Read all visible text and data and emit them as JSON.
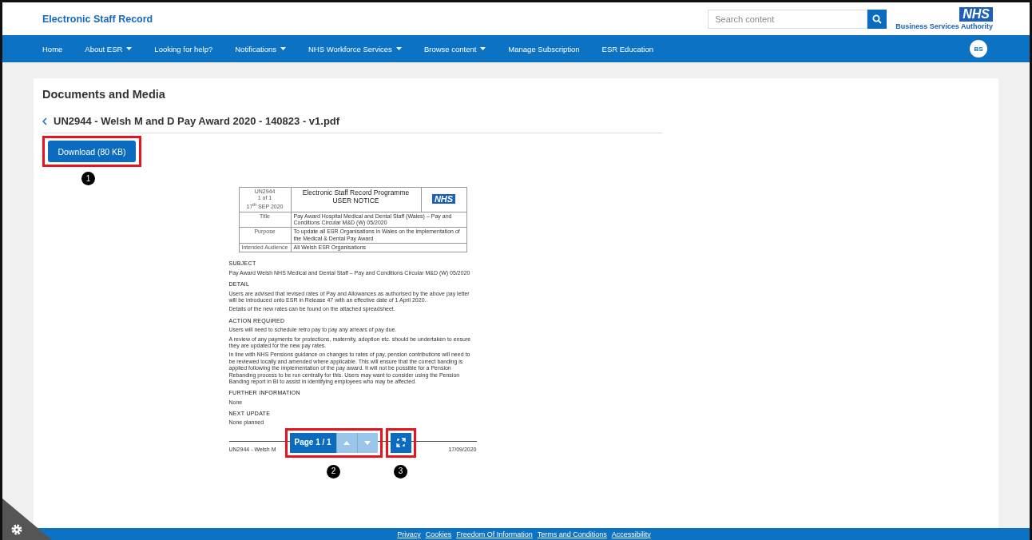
{
  "header": {
    "title": "Electronic Staff Record",
    "search": {
      "placeholder": "Search content"
    },
    "logo": {
      "mark": "NHS",
      "subtitle": "Business Services Authority"
    }
  },
  "nav": {
    "items": [
      {
        "label": "Home",
        "dropdown": false
      },
      {
        "label": "About ESR",
        "dropdown": true
      },
      {
        "label": "Looking for help?",
        "dropdown": false
      },
      {
        "label": "Notifications",
        "dropdown": true
      },
      {
        "label": "NHS Workforce Services",
        "dropdown": true
      },
      {
        "label": "Browse content",
        "dropdown": true
      },
      {
        "label": "Manage Subscription",
        "dropdown": false
      },
      {
        "label": "ESR Education",
        "dropdown": false
      }
    ],
    "avatar": "BS"
  },
  "page": {
    "heading": "Documents and Media",
    "file_title": "UN2944 - Welsh M and D Pay Award 2020 - 140823 - v1.pdf",
    "download": {
      "label": "Download (80 KB)",
      "callout": "1"
    }
  },
  "document": {
    "ref": "UN2944",
    "pages": "1 of 1",
    "date": "17$^{th}$ SEP 2020",
    "programme": "Electronic Staff Record Programme",
    "notice_type": "USER NOTICE",
    "logo": "NHS",
    "rows": [
      {
        "label": "Title",
        "value": "Pay Award Hospital Medical and Dental Staff (Wales) – Pay and Conditions Circular M&D (W) 05/2020"
      },
      {
        "label": "Purpose",
        "value": "To update all ESR Organisations in Wales on the implementation of the Medical & Dental Pay Award"
      },
      {
        "label": "Intended Audience",
        "value": "All Welsh ESR Organisations"
      }
    ],
    "sections": [
      {
        "kind": "heading",
        "text": "SUBJECT"
      },
      {
        "kind": "paragraph",
        "text": "Pay Award Welsh NHS Medical and Dental Staff – Pay and Conditions Circular M&D (W) 05/2020"
      },
      {
        "kind": "heading",
        "text": "DETAIL"
      },
      {
        "kind": "paragraph",
        "text": "Users are advised that revised rates of Pay and Allowances as authorised by the above pay letter will be introduced onto ESR in Release 47 with an effective date of 1 April 2020."
      },
      {
        "kind": "paragraph",
        "text": "Details of the new rates can be found on the attached spreadsheet."
      },
      {
        "kind": "heading",
        "text": "ACTION REQUIRED"
      },
      {
        "kind": "paragraph",
        "text": "Users will need to schedule retro pay to pay any arrears of pay due."
      },
      {
        "kind": "paragraph",
        "text": "A review of any payments for protections, maternity, adoption etc. should be undertaken to ensure they are updated for the new pay rates."
      },
      {
        "kind": "paragraph",
        "text": "In line with NHS Pensions guidance on changes to rates of pay, pension contributions will need to be reviewed locally and amended where applicable.  This will ensure that the correct banding is applied following the implementation of the pay award. It will not be possible for a Pension Rebanding process to be run centrally for this.  Users may want to consider using the Pension Banding report in BI to assist in identifying employees who may be affected."
      },
      {
        "kind": "heading",
        "text": "FURTHER INFORMATION"
      },
      {
        "kind": "paragraph",
        "text": "None"
      },
      {
        "kind": "heading",
        "text": "NEXT UPDATE"
      },
      {
        "kind": "paragraph",
        "text": "None planned"
      }
    ],
    "footer_left": "UN2944 - Welsh M",
    "footer_right": "17/09/2020"
  },
  "pager": {
    "label": "Page 1 / 1",
    "previous": {
      "disabled": true
    },
    "next": {
      "disabled": true
    },
    "callout": "2"
  },
  "fullscreen": {
    "callout": "3"
  },
  "footer": {
    "links": [
      "Privacy",
      "Cookies",
      "Freedom Of Information",
      "Terms and Conditions",
      "Accessibility"
    ]
  }
}
